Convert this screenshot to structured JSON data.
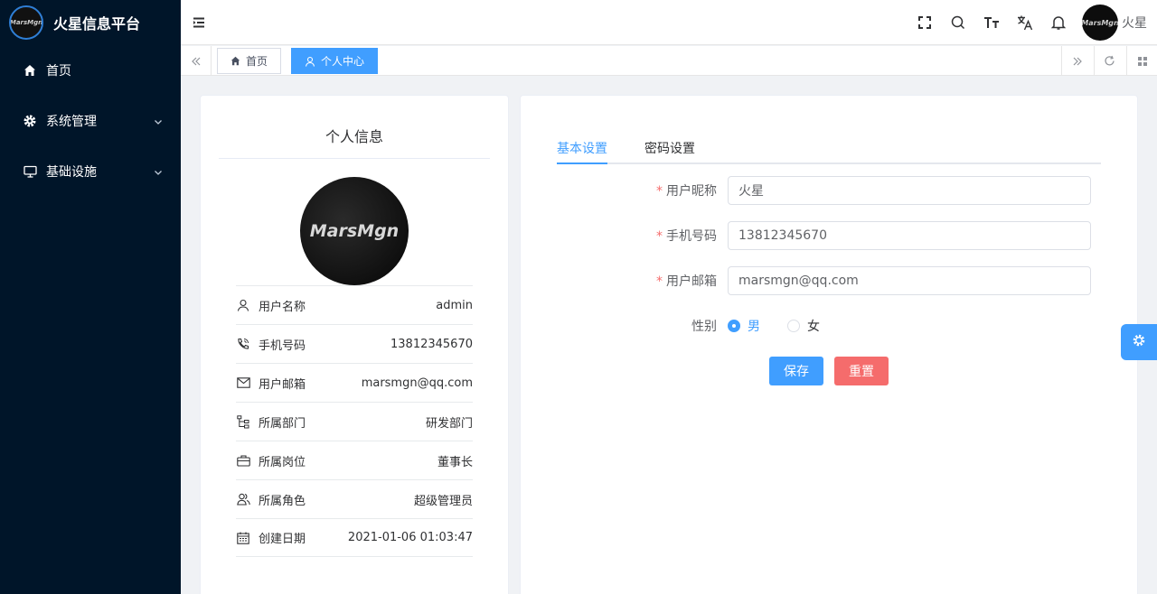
{
  "app": {
    "title": "火星信息平台",
    "logo_text": "MarsMgn"
  },
  "sidebar": {
    "items": [
      {
        "label": "首页",
        "icon": "home-icon"
      },
      {
        "label": "系统管理",
        "icon": "gear-icon",
        "expandable": true
      },
      {
        "label": "基础设施",
        "icon": "monitor-icon",
        "expandable": true
      }
    ]
  },
  "navbar": {
    "user_name": "火星",
    "avatar_text": "MarsMgn"
  },
  "tags": [
    {
      "label": "首页",
      "active": false
    },
    {
      "label": "个人中心",
      "active": true
    }
  ],
  "profile": {
    "title": "个人信息",
    "avatar_text": "MarsMgn",
    "rows": [
      {
        "label": "用户名称",
        "value": "admin",
        "icon": "user-icon"
      },
      {
        "label": "手机号码",
        "value": "13812345670",
        "icon": "phone-icon"
      },
      {
        "label": "用户邮箱",
        "value": "marsmgn@qq.com",
        "icon": "mail-icon"
      },
      {
        "label": "所属部门",
        "value": "研发部门",
        "icon": "tree-icon"
      },
      {
        "label": "所属岗位",
        "value": "董事长",
        "icon": "briefcase-icon"
      },
      {
        "label": "所属角色",
        "value": "超级管理员",
        "icon": "users-icon"
      },
      {
        "label": "创建日期",
        "value": "2021-01-06 01:03:47",
        "icon": "calendar-icon"
      }
    ]
  },
  "settings": {
    "tabs": [
      {
        "label": "基本设置",
        "active": true
      },
      {
        "label": "密码设置",
        "active": false
      }
    ],
    "form": {
      "nickname": {
        "label": "用户昵称",
        "value": "火星",
        "required": true
      },
      "phone": {
        "label": "手机号码",
        "value": "13812345670",
        "required": true
      },
      "email": {
        "label": "用户邮箱",
        "value": "marsmgn@qq.com",
        "required": true
      },
      "gender": {
        "label": "性别",
        "options": [
          "男",
          "女"
        ],
        "selected": "男"
      }
    },
    "save_label": "保存",
    "reset_label": "重置"
  },
  "colors": {
    "primary": "#409eff",
    "danger": "#f56c6c",
    "sidebar_bg": "#001529"
  }
}
